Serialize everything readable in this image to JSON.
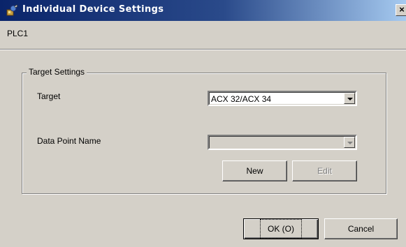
{
  "window": {
    "title": "Individual Device Settings",
    "close_label": "×",
    "device_name": "PLC1"
  },
  "target_settings": {
    "legend": "Target Settings",
    "target_label": "Target",
    "target_value": "ACX 32/ACX 34",
    "data_point_label": "Data Point Name",
    "data_point_value": "",
    "new_label": "New",
    "edit_label": "Edit"
  },
  "footer": {
    "ok_label": "OK (O)",
    "cancel_label": "Cancel"
  },
  "icons": {
    "app": "settings-wrench-icon",
    "close": "close-icon",
    "dropdown": "chevron-down-icon"
  }
}
